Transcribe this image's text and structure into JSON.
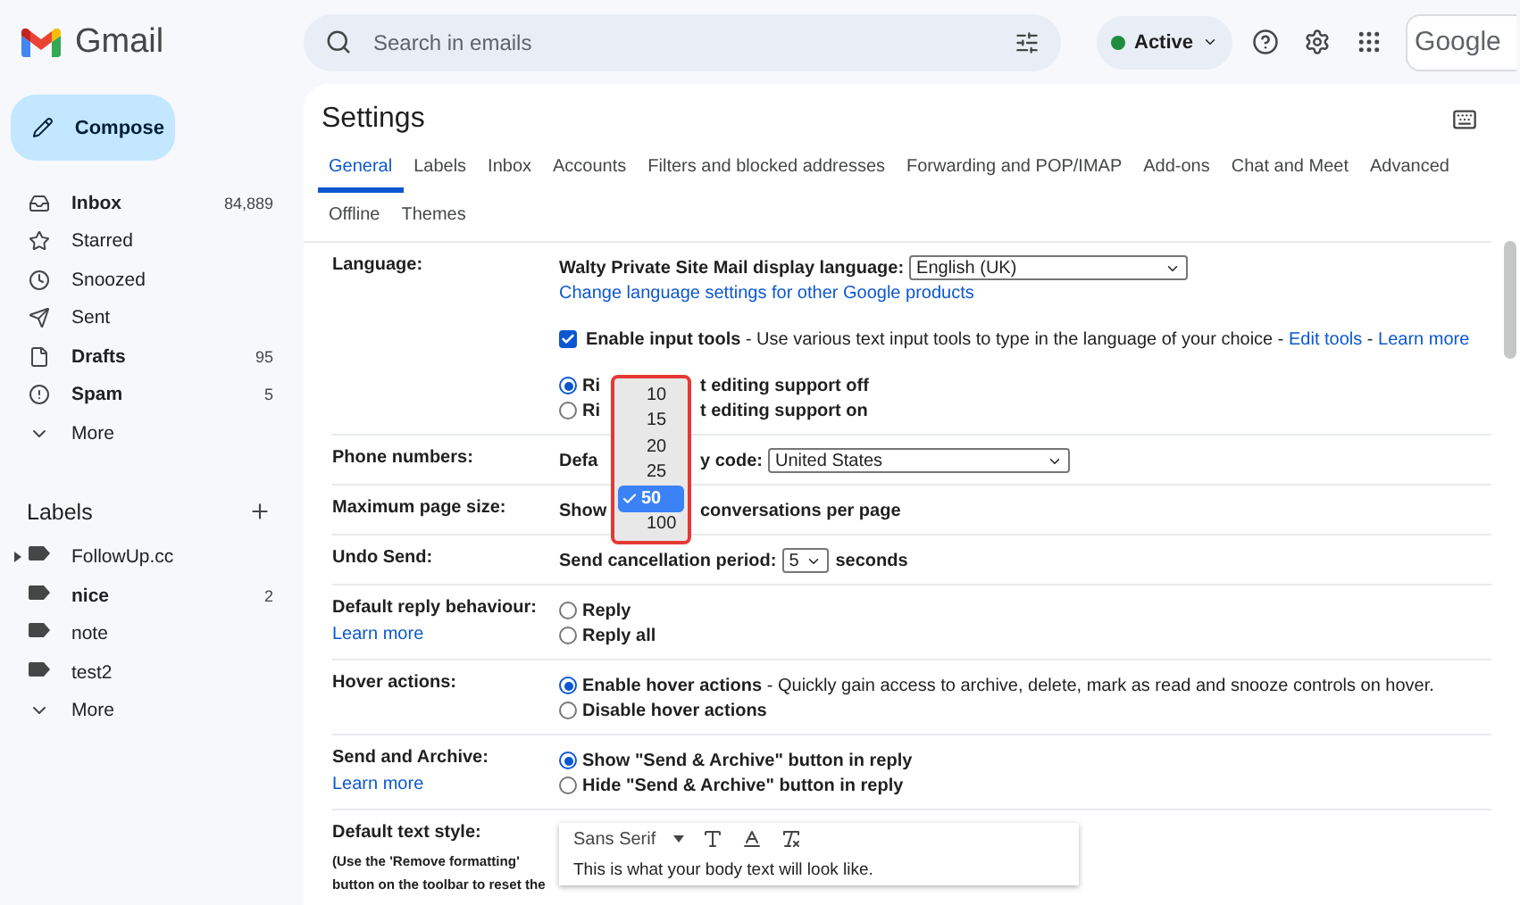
{
  "header": {
    "brand": "Gmail",
    "search_placeholder": "Search in emails",
    "status": "Active",
    "account": "Google"
  },
  "sidebar": {
    "compose": "Compose",
    "folders": [
      {
        "label": "Inbox",
        "count": "84,889",
        "unread": true
      },
      {
        "label": "Starred",
        "unread": false
      },
      {
        "label": "Snoozed",
        "unread": false
      },
      {
        "label": "Sent",
        "unread": false
      },
      {
        "label": "Drafts",
        "count": "95",
        "unread": true
      },
      {
        "label": "Spam",
        "count": "5",
        "unread": true
      },
      {
        "label": "More",
        "unread": false
      }
    ],
    "labels_heading": "Labels",
    "labels": [
      {
        "label": "FollowUp.cc",
        "unread": false,
        "kind": "parent"
      },
      {
        "label": "nice",
        "count": "2",
        "unread": true,
        "kind": "leaf"
      },
      {
        "label": "note",
        "unread": false,
        "kind": "leaf"
      },
      {
        "label": "test2",
        "unread": false,
        "kind": "leaf"
      },
      {
        "label": "More",
        "unread": false,
        "kind": "more"
      }
    ]
  },
  "settings": {
    "title": "Settings",
    "tab_rows": [
      [
        {
          "label": "General",
          "selected": true
        },
        {
          "label": "Labels",
          "selected": false
        },
        {
          "label": "Inbox",
          "selected": false
        },
        {
          "label": "Accounts",
          "selected": false
        },
        {
          "label": "Filters and blocked addresses",
          "selected": false
        },
        {
          "label": "Forwarding and POP/IMAP",
          "selected": false
        },
        {
          "label": "Add-ons",
          "selected": false
        },
        {
          "label": "Chat and Meet",
          "selected": false
        },
        {
          "label": "Advanced",
          "selected": false
        }
      ],
      [
        {
          "label": "Offline",
          "selected": false
        },
        {
          "label": "Themes",
          "selected": false
        }
      ]
    ],
    "rows": [
      {
        "label": "Language:",
        "lines": [
          {
            "kind": "text",
            "parts": [
              {
                "kind": "bold",
                "text": "Walty Private Site Mail display language:"
              },
              {
                "kind": "select",
                "text": "English (UK)"
              }
            ]
          },
          {
            "kind": "text",
            "parts": [
              {
                "kind": "link",
                "text": "Change language settings for other Google products"
              }
            ]
          },
          {
            "kind": "checkbox",
            "checked": true,
            "parts": [
              {
                "kind": "bold",
                "text": "Enable input tools"
              },
              {
                "kind": "plain",
                "text": " - Use various text input tools to type in the language of your choice - "
              },
              {
                "kind": "link",
                "text": "Edit tools"
              },
              {
                "kind": "plain",
                "text": " - "
              },
              {
                "kind": "link",
                "text": "Learn more"
              }
            ]
          },
          {
            "kind": "radio",
            "selected": true,
            "parts": [
              {
                "kind": "bold",
                "text": "Ri"
              },
              {
                "kind": "covered"
              },
              {
                "kind": "bold",
                "text": "t editing support off"
              }
            ]
          },
          {
            "kind": "radio",
            "selected": false,
            "parts": [
              {
                "kind": "bold",
                "text": "Ri"
              },
              {
                "kind": "covered"
              },
              {
                "kind": "bold",
                "text": "t editing support on"
              }
            ]
          }
        ]
      },
      {
        "label": "Phone numbers:",
        "lines": [
          {
            "kind": "text",
            "parts": [
              {
                "kind": "bold",
                "text": "Defa"
              },
              {
                "kind": "covered"
              },
              {
                "kind": "bold",
                "text": "y code:"
              },
              {
                "kind": "select",
                "text": "United States"
              }
            ]
          }
        ]
      },
      {
        "label": "Maximum page size:",
        "lines": [
          {
            "kind": "text",
            "parts": [
              {
                "kind": "bold",
                "text": "Show"
              },
              {
                "kind": "covered"
              },
              {
                "kind": "bold",
                "text": "conversations per page"
              }
            ]
          }
        ]
      },
      {
        "label": "Undo Send:",
        "lines": [
          {
            "kind": "text",
            "parts": [
              {
                "kind": "bold",
                "text": "Send cancellation period:"
              },
              {
                "kind": "select",
                "text": "5"
              },
              {
                "kind": "bold",
                "text": "seconds"
              }
            ]
          }
        ]
      },
      {
        "label": "Default reply behaviour:",
        "link": "Learn more",
        "lines": [
          {
            "kind": "radio",
            "selected": false,
            "parts": [
              {
                "kind": "bold",
                "text": "Reply"
              }
            ]
          },
          {
            "kind": "radio",
            "selected": false,
            "parts": [
              {
                "kind": "bold",
                "text": "Reply all"
              }
            ]
          }
        ]
      },
      {
        "label": "Hover actions:",
        "lines": [
          {
            "kind": "radio",
            "selected": true,
            "parts": [
              {
                "kind": "bold",
                "text": "Enable hover actions"
              },
              {
                "kind": "plain",
                "text": " - Quickly gain access to archive, delete, mark as read and snooze controls on hover."
              }
            ]
          },
          {
            "kind": "radio",
            "selected": false,
            "parts": [
              {
                "kind": "bold",
                "text": "Disable hover actions"
              }
            ]
          }
        ]
      },
      {
        "label": "Send and Archive:",
        "link": "Learn more",
        "lines": [
          {
            "kind": "radio",
            "selected": true,
            "parts": [
              {
                "kind": "bold",
                "text": "Show \"Send & Archive\" button in reply"
              }
            ]
          },
          {
            "kind": "radio",
            "selected": false,
            "parts": [
              {
                "kind": "bold",
                "text": "Hide \"Send & Archive\" button in reply"
              }
            ]
          }
        ]
      },
      {
        "label": "Default text style:",
        "note": "(Use the 'Remove formatting' button on the toolbar to reset the",
        "lines": [
          {
            "kind": "editor",
            "font": "Sans Serif",
            "sample": "This is what your body text will look like."
          }
        ]
      }
    ],
    "page_size_menu": [
      {
        "label": "10",
        "selected": false
      },
      {
        "label": "15",
        "selected": false
      },
      {
        "label": "20",
        "selected": false
      },
      {
        "label": "25",
        "selected": false
      },
      {
        "label": "50",
        "selected": true
      },
      {
        "label": "100",
        "selected": false
      }
    ]
  }
}
